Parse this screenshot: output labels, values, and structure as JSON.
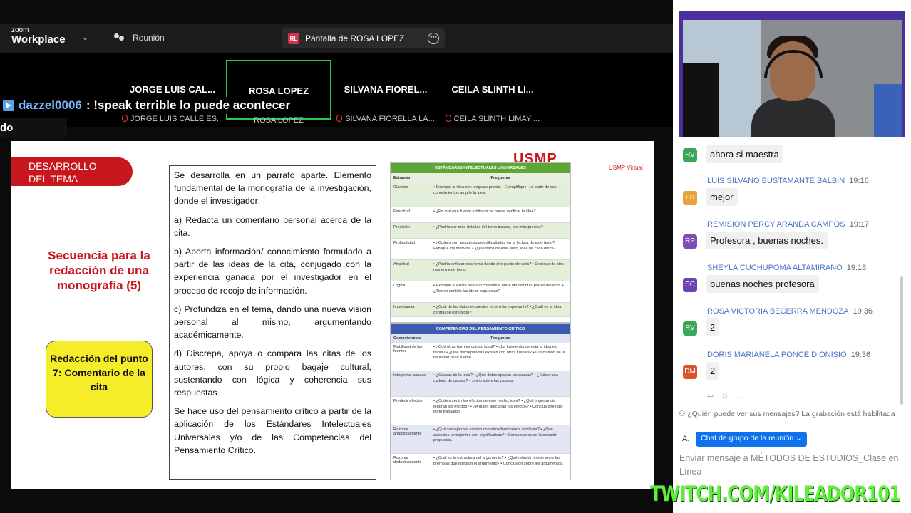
{
  "app": {
    "logo_small": "zoom",
    "logo_big": "Workplace"
  },
  "meeting": {
    "label": "Reunión"
  },
  "share": {
    "initials": "RL",
    "label": "Pantalla de ROSA LOPEZ"
  },
  "participants": [
    {
      "name": "JORGE LUIS CAL...",
      "sub": "JORGE LUIS CALLE ES..."
    },
    {
      "name": "ROSA LOPEZ",
      "sub": "ROSA LOPEZ"
    },
    {
      "name": "SILVANA FIOREL...",
      "sub": "SILVANA FIORELLA LA..."
    },
    {
      "name": "CEILA SLINTH LI...",
      "sub": "CEILA SLINTH LIMAY ..."
    }
  ],
  "stream_chat": {
    "user": "dazzel0006",
    "message": ": !speak terrible lo puede acontecer",
    "fragment": "do"
  },
  "slide": {
    "banner": [
      "DESARROLLO",
      "DEL TEMA"
    ],
    "sequence_title": "Secuencia para la redacción de una monografía (5)",
    "callout": "Redacción del punto 7: Comentario de la cita",
    "brand": "USMP",
    "brand_sub": "USMP Virtual",
    "paragraphs": [
      "Se desarrolla en un párrafo aparte. Elemento fundamental de la monografía de la investigación, donde el investigador:",
      "a) Redacta un comentario personal acerca de la cita.",
      "b) Aporta información/ conocimiento formulado a partir de las ideas de la cita, conjugado con la experiencia ganada por el investigador en el proceso de recojo de información.",
      "c) Profundiza en el tema, dando una nueva visión personal al mismo, argumentando académicamente.",
      "d) Discrepa, apoya o compara las citas de los autores, con su propio bagaje cultural, sustentando con lógica y coherencia sus respuestas.",
      "Se hace uso del pensamiento crítico a partir de la aplicación de los Estándares Intelectuales Universales y/o de las Competencias del Pensamiento Crítico."
    ],
    "table1": {
      "title": "ESTÁNDARES INTELECTUALES UNIVERSALES",
      "col1": "Estándar",
      "col2": "Preguntas",
      "rows": [
        [
          "Claridad",
          "• Explique la idea con lenguaje propio. • Ejemplifique. • A partir de sus conocimientos amplíe la idea."
        ],
        [
          "Exactitud",
          "• ¿En qué otra fuente arbitrada se puede verificar la idea?"
        ],
        [
          "Precisión",
          "• ¿Podría dar más detalles del tema tratado, ser más preciso?"
        ],
        [
          "Profundidad",
          "• ¿Cuáles son las principales dificultades en la lectura de este texto? Explique los motivos. • ¿Qué hace de este texto, idea un caso difícil?"
        ],
        [
          "Amplitud",
          "• ¿Podría enfocar este tema desde otro punto de vista? • Explique de otra manera este tema."
        ],
        [
          "Lógica",
          "• Explique si existe relación coherente entre las distintas partes del libro. • ¿Tienen sentido las ideas expuestas?"
        ],
        [
          "Importancia",
          "• ¿Cuál de los datos expuestos es el más importante? • ¿Cuál es la idea central de este texto?"
        ]
      ]
    },
    "table2": {
      "title": "COMPETENCIAS DEL PENSAMIENTO CRÍTICO",
      "col1": "Competencias",
      "col2": "Preguntas",
      "rows": [
        [
          "Fiabilidad de las fuentes",
          "• ¿Qué otras fuentes opinan igual? • ¿La fuente donde está la idea es fiable? • ¿Qué discrepancias existen con otras fuentes? • Conclusión de la fiabilidad de la fuente."
        ],
        [
          "Interpretar causas",
          "• ¿Causas de la idea? • ¿Qué datos apoyan las causas? • ¿Existe una cadena de causas? • Juicio sobre las causas."
        ],
        [
          "Predecir efectos",
          "• ¿Cuáles serán los efectos de este hecho, idea? • ¿Qué importancia tendrán los efectos? • ¿A quién afectarán los efectos? • Conclusiones del texto trabajado."
        ],
        [
          "Razonar analógicamente",
          "• ¿Qué semejanzas existen con otros fenómenos similares? • ¿Qué aspectos semejantes son significativos? • Conclusiones de la solución propuesta."
        ],
        [
          "Razonar deductivamente",
          "• ¿Cuál es la estructura del argumento? • ¿Qué relación existe entre las premisas que integran el argumento? • Conclusión sobre los argumentos."
        ]
      ]
    }
  },
  "chat": {
    "messages": [
      {
        "initials": "RV",
        "color": "#3aa757",
        "sender": "",
        "time": "",
        "text": "ahora si maestra"
      },
      {
        "initials": "LS",
        "color": "#e8a23a",
        "sender": "LUIS SILVANO BUSTAMANTE BALBIN",
        "time": "19:16",
        "text": "mejor"
      },
      {
        "initials": "RP",
        "color": "#7b4fb5",
        "sender": "REMISION PERCY ARANDA CAMPOS",
        "time": "19:17",
        "text": "Profesora , buenas noches."
      },
      {
        "initials": "SC",
        "color": "#6a43b0",
        "sender": "SHEYLA CUCHUPOMA ALTAMIRANO",
        "time": "19:18",
        "text": "buenas noches profesora"
      },
      {
        "initials": "RV",
        "color": "#3aa757",
        "sender": "ROSA VICTORIA BECERRA MENDOZA",
        "time": "19:36",
        "text": "2"
      },
      {
        "initials": "DM",
        "color": "#d9542b",
        "sender": "DORIS MARIANELA PONCE DIONISIO",
        "time": "19:36",
        "text": "2"
      }
    ],
    "visibility_note": "¿Quién puede ver sus mensajes? La grabación está habilitada",
    "to_label": "A:",
    "to_target": "Chat de grupo de la reunión",
    "compose_placeholder": "Enviar mensaje a MÉTODOS DE ESTUDIOS_Clase en Línea"
  },
  "watermark": "TWITCH.COM/KILEADOR101"
}
